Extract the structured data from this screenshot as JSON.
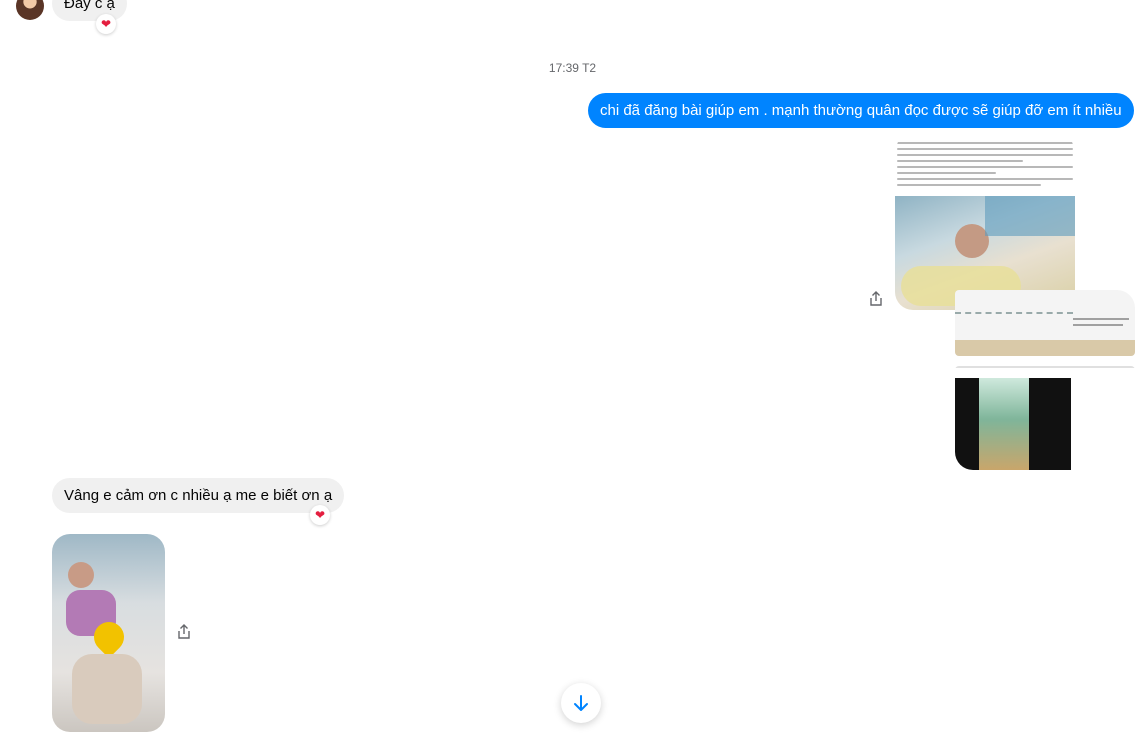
{
  "messages": {
    "top_incoming_text": "Đây c ạ",
    "timestamp": "17:39 T2",
    "outgoing_text": "chi đã đăng bài giúp em . mạnh thường quân đọc được sẽ giúp đỡ em ít nhiều",
    "incoming_reply_text": "Vâng e cảm ơn c nhiều ạ me e biết ơn ạ"
  },
  "reactions": {
    "heart": "❤"
  },
  "icons": {
    "share": "share-icon",
    "scroll_down": "arrow-down-icon"
  },
  "colors": {
    "outgoing_bubble": "#0084ff",
    "incoming_bubble": "#f0f0f0",
    "reaction_heart": "#e41e3f"
  }
}
